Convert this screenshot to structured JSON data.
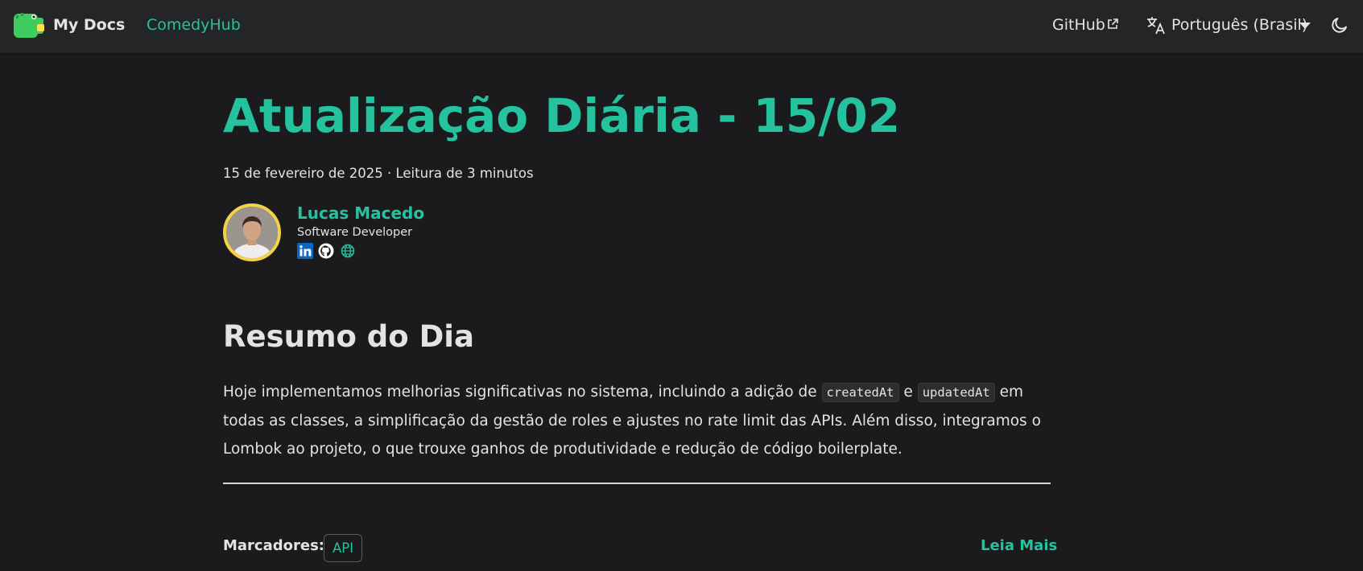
{
  "navbar": {
    "brand": "My Docs",
    "links": {
      "comedyhub": "ComedyHub",
      "github": "GitHub",
      "language": "Português (Brasil)"
    },
    "icons": [
      "dinosaur-logo-icon",
      "external-link-icon",
      "translate-icon",
      "chevron-down-icon",
      "moon-icon"
    ]
  },
  "post": {
    "title": "Atualização Diária - 15/02",
    "meta": "15 de fevereiro de 2025 · Leitura de 3 minutos",
    "author": {
      "name": "Lucas Macedo",
      "role": "Software Developer",
      "social_icons": [
        "linkedin-icon",
        "github-icon",
        "globe-icon"
      ]
    },
    "section_heading": "Resumo do Dia",
    "paragraph": {
      "part1": "Hoje implementamos melhorias significativas no sistema, incluindo a adição de ",
      "code1": "createdAt",
      "part2": " e ",
      "code2": "updatedAt",
      "part3": " em todas as classes, a simplificação da gestão de roles e ajustes no rate limit das APIs. Além disso, integramos o Lombok ao projeto, o que trouxe ganhos de produtividade e redução de código boilerplate."
    },
    "tags_label": "Marcadores:",
    "tags": [
      "API"
    ],
    "read_more": "Leia Mais"
  },
  "colors": {
    "accent": "#25c2a0",
    "background": "#1b1b1d",
    "navbar": "#242526",
    "avatar_ring": "#f5d146"
  }
}
